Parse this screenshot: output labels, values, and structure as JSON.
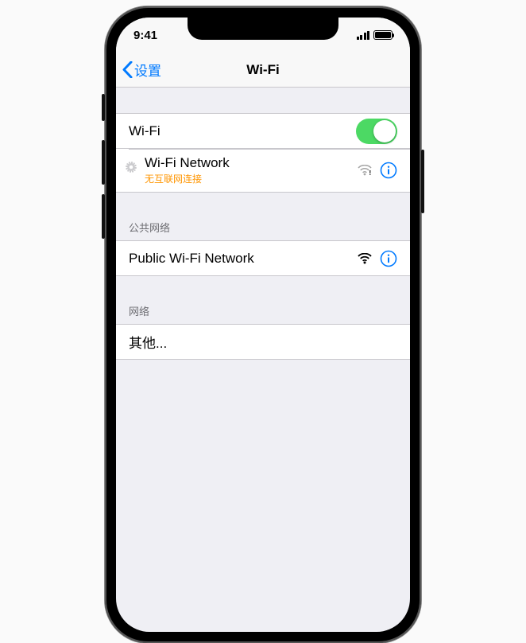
{
  "status": {
    "time": "9:41"
  },
  "nav": {
    "back_label": "设置",
    "title": "Wi-Fi"
  },
  "toggle_row": {
    "label": "Wi-Fi",
    "on": true
  },
  "current_network": {
    "name": "Wi-Fi Network",
    "status_text": "无互联网连接"
  },
  "sections": {
    "public_header": "公共网络",
    "networks_header": "网络"
  },
  "public_network": {
    "name": "Public Wi-Fi Network"
  },
  "other_row": {
    "label": "其他..."
  },
  "colors": {
    "link": "#007aff",
    "warning": "#ff9500",
    "toggle_on": "#4cd964"
  }
}
